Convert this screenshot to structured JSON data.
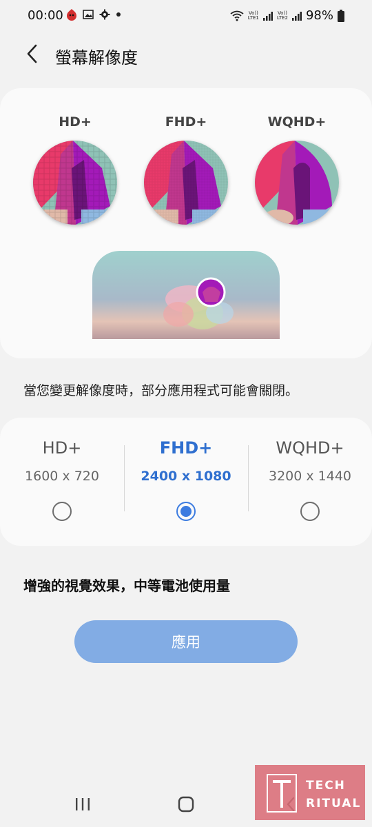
{
  "status": {
    "time": "00:00",
    "battery": "98%",
    "sim1": "LTE1",
    "sim2": "LTE2",
    "volte": "Vo))"
  },
  "header": {
    "title": "螢幕解像度"
  },
  "preview": {
    "labels": [
      "HD+",
      "FHD+",
      "WQHD+"
    ]
  },
  "notice": "當您變更解像度時，部分應用程式可能會關閉。",
  "options": [
    {
      "name": "HD+",
      "resolution": "1600 x 720",
      "selected": false
    },
    {
      "name": "FHD+",
      "resolution": "2400 x 1080",
      "selected": true
    },
    {
      "name": "WQHD+",
      "resolution": "3200 x 1440",
      "selected": false
    }
  ],
  "description": "增強的視覺效果，中等電池使用量",
  "apply_label": "應用",
  "watermark": {
    "line1": "TECH",
    "line2": "RITUAL"
  },
  "colors": {
    "accent": "#3b7be0",
    "apply_button": "#82ace4",
    "watermark": "#da6c76"
  }
}
